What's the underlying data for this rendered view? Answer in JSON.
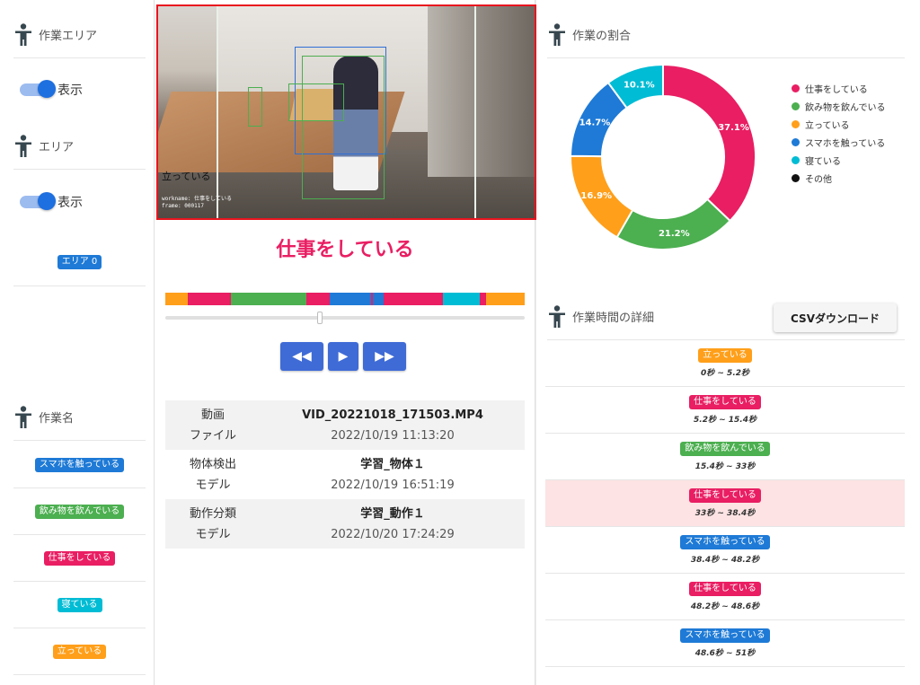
{
  "colors": {
    "working": "#e91e63",
    "drinking": "#4caf50",
    "standing": "#ff9f1a",
    "smartphone": "#1e7ad6",
    "sleeping": "#00bcd4",
    "other": "#111111"
  },
  "sidebar": {
    "work_area_header": "作業エリア",
    "work_area_toggle": "表示",
    "area_header": "エリア",
    "area_toggle": "表示",
    "area_chip": "エリア 0",
    "task_header": "作業名",
    "tasks": [
      {
        "label": "スマホを触っている",
        "color": "#1e7ad6"
      },
      {
        "label": "飲み物を飲んでいる",
        "color": "#4caf50"
      },
      {
        "label": "仕事をしている",
        "color": "#e91e63"
      },
      {
        "label": "寝ている",
        "color": "#00bcd4"
      },
      {
        "label": "立っている",
        "color": "#ff9f1a"
      }
    ]
  },
  "video": {
    "overlay_label": "立っている",
    "overlay_small_1": "workname: 仕事をしている",
    "overlay_small_2": "frame: 000117",
    "current_task": "仕事をしている",
    "timeline": [
      {
        "from": 0,
        "to": 5.2,
        "color": "#ff9f1a"
      },
      {
        "from": 5.2,
        "to": 15.4,
        "color": "#e91e63"
      },
      {
        "from": 15.4,
        "to": 33,
        "color": "#4caf50"
      },
      {
        "from": 33,
        "to": 38.4,
        "color": "#e91e63"
      },
      {
        "from": 38.4,
        "to": 48.2,
        "color": "#1e7ad6"
      },
      {
        "from": 48.2,
        "to": 48.6,
        "color": "#e91e63"
      },
      {
        "from": 48.6,
        "to": 51,
        "color": "#1e7ad6"
      },
      {
        "from": 51,
        "to": 65,
        "color": "#e91e63"
      },
      {
        "from": 65,
        "to": 73.5,
        "color": "#00bcd4"
      },
      {
        "from": 73.5,
        "to": 75,
        "color": "#e91e63"
      },
      {
        "from": 75,
        "to": 84,
        "color": "#ff9f1a"
      }
    ],
    "timeline_total": 84,
    "playback_position": 0.43,
    "controls": {
      "rewind": "◀◀",
      "play": "▶",
      "forward": "▶▶"
    }
  },
  "info": [
    {
      "key": "動画\nファイル",
      "title": "VID_20221018_171503.MP4",
      "date": "2022/10/19 11:13:20"
    },
    {
      "key": "物体検出\nモデル",
      "title": "学習_物体１",
      "date": "2022/10/19 16:51:19"
    },
    {
      "key": "動作分類\nモデル",
      "title": "学習_動作１",
      "date": "2022/10/20 17:24:29"
    }
  ],
  "ratio": {
    "header": "作業の割合",
    "chart_data": {
      "type": "pie",
      "categories": [
        "仕事をしている",
        "飲み物を飲んでいる",
        "立っている",
        "スマホを触っている",
        "寝ている",
        "その他"
      ],
      "values": [
        37.1,
        21.2,
        16.9,
        14.7,
        10.1,
        0
      ],
      "labels": [
        "37.1%",
        "21.2%",
        "16.9%",
        "14.7%",
        "10.1%",
        ""
      ],
      "colors": [
        "#e91e63",
        "#4caf50",
        "#ff9f1a",
        "#1e7ad6",
        "#00bcd4",
        "#111111"
      ],
      "legend": "right"
    }
  },
  "details": {
    "header": "作業時間の詳細",
    "csv_button": "CSVダウンロード",
    "rows": [
      {
        "label": "立っている",
        "color": "#ff9f1a",
        "range": "0秒 ~ 5.2秒",
        "highlight": false
      },
      {
        "label": "仕事をしている",
        "color": "#e91e63",
        "range": "5.2秒 ~ 15.4秒",
        "highlight": false
      },
      {
        "label": "飲み物を飲んでいる",
        "color": "#4caf50",
        "range": "15.4秒 ~ 33秒",
        "highlight": false
      },
      {
        "label": "仕事をしている",
        "color": "#e91e63",
        "range": "33秒 ~ 38.4秒",
        "highlight": true
      },
      {
        "label": "スマホを触っている",
        "color": "#1e7ad6",
        "range": "38.4秒 ~ 48.2秒",
        "highlight": false
      },
      {
        "label": "仕事をしている",
        "color": "#e91e63",
        "range": "48.2秒 ~ 48.6秒",
        "highlight": false
      },
      {
        "label": "スマホを触っている",
        "color": "#1e7ad6",
        "range": "48.6秒 ~ 51秒",
        "highlight": false
      }
    ]
  }
}
